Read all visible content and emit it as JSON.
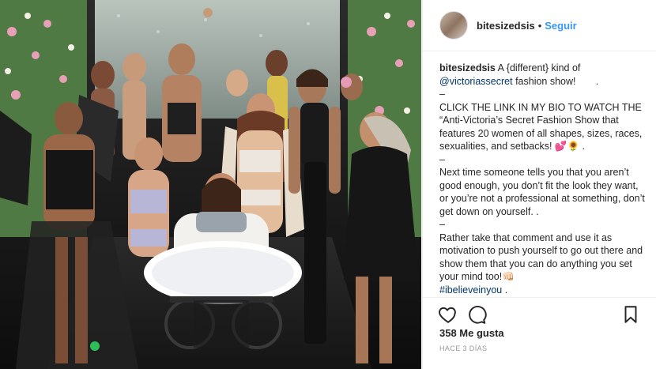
{
  "post": {
    "username": "bitesizedsis",
    "separator": "•",
    "follow_label": "Seguir",
    "caption": {
      "username": "bitesizedsis",
      "line1": "A {different} kind of",
      "mention": "@victoriassecret",
      "line1b": "fashion show! ⠀⠀ .",
      "dash1": "–",
      "para1": "CLICK THE LINK IN MY BIO TO WATCH THE “Anti-Victoria’s Secret Fashion Show that features 20 women of all shapes, sizes, races, sexualities, and setbacks! 💕🌻 .",
      "dash2": "–",
      "para2": "Next time someone tells you that you aren’t good enough, you don’t fit the look they want, or you’re not a professional at something, don’t get down on yourself. .",
      "dash3": "–",
      "para3": "Rather take that comment and use it as motivation to push yourself to go out there and show them that you can do anything you set your mind too!👊🏻",
      "hashtag": "#ibelieveinyou",
      "end": "."
    },
    "likes_label": "358 Me gusta",
    "timestamp": "HACE 3 DÍAS"
  },
  "icons": {
    "like": "heart-icon",
    "comment": "comment-icon",
    "save": "bookmark-icon"
  },
  "colors": {
    "accent": "#3897f0",
    "link": "#003569",
    "text": "#262626",
    "muted": "#999999"
  }
}
